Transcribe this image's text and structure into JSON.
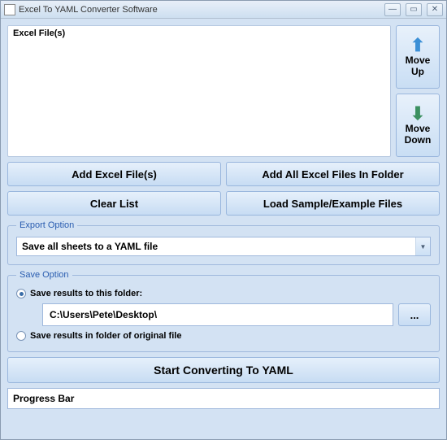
{
  "window": {
    "title": "Excel To YAML Converter Software"
  },
  "list": {
    "column_header": "Excel File(s)"
  },
  "move": {
    "up_label": "Move\nUp",
    "down_label": "Move\nDown"
  },
  "buttons": {
    "add_files": "Add Excel File(s)",
    "add_folder": "Add All Excel Files In Folder",
    "clear": "Clear List",
    "load_sample": "Load Sample/Example Files",
    "start": "Start Converting To YAML",
    "browse": "..."
  },
  "export_option": {
    "legend": "Export Option",
    "selected": "Save all sheets to a YAML file"
  },
  "save_option": {
    "legend": "Save Option",
    "to_folder_label": "Save results to this folder:",
    "folder_path": "C:\\Users\\Pete\\Desktop\\",
    "original_folder_label": "Save results in folder of original file",
    "selected": "to_folder"
  },
  "progress": {
    "label": "Progress Bar"
  }
}
